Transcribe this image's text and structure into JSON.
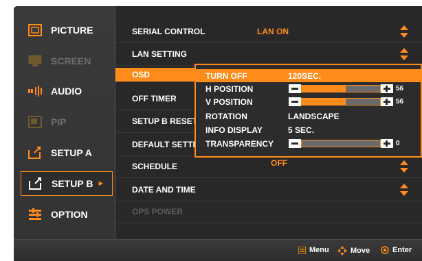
{
  "colors": {
    "accent": "#ff8c1a",
    "background": "#2a2a2a",
    "dim_text": "#5e5e5e"
  },
  "left_menu": {
    "items": [
      {
        "label": "PICTURE",
        "icon": "picture-icon",
        "state": "normal"
      },
      {
        "label": "SCREEN",
        "icon": "screen-icon",
        "state": "disabled"
      },
      {
        "label": "AUDIO",
        "icon": "audio-icon",
        "state": "normal"
      },
      {
        "label": "PIP",
        "icon": "pip-icon",
        "state": "disabled"
      },
      {
        "label": "SETUP A",
        "icon": "setup-a-icon",
        "state": "normal"
      },
      {
        "label": "SETUP B",
        "icon": "setup-b-icon",
        "state": "selected",
        "arrow": "►"
      },
      {
        "label": "OPTION",
        "icon": "option-icon",
        "state": "normal"
      }
    ]
  },
  "setup_b": {
    "rows": [
      {
        "label": "SERIAL CONTROL",
        "value": "LAN ON",
        "has_arrows": true
      },
      {
        "label": "LAN SETTING",
        "value": "",
        "has_arrows": true
      },
      {
        "label": "OSD",
        "value": "",
        "has_arrows": false,
        "highlighted": true
      },
      {
        "label": "OFF TIMER",
        "value": "",
        "has_arrows": false
      },
      {
        "label": "SETUP B RESET",
        "value": "",
        "has_arrows": false
      },
      {
        "label": "DEFAULT SETTING",
        "value": "",
        "has_arrows": false
      },
      {
        "label": "SCHEDULE",
        "value": "OFF",
        "has_arrows": true
      },
      {
        "label": "DATE AND TIME",
        "value": "",
        "has_arrows": true
      },
      {
        "label": "OPS POWER",
        "value": "",
        "has_arrows": false,
        "disabled": true
      }
    ]
  },
  "osd_submenu": {
    "turn_off": {
      "label": "TURN OFF",
      "value": "120SEC."
    },
    "h_position": {
      "label": "H POSITION",
      "value": "56",
      "level": 0.56
    },
    "v_position": {
      "label": "V POSITION",
      "value": "56",
      "level": 0.56
    },
    "rotation": {
      "label": "ROTATION",
      "value": "LANDSCAPE"
    },
    "info_display": {
      "label": "INFO DISPLAY",
      "value": "5 SEC."
    },
    "transparency": {
      "label": "TRANSPARENCY",
      "value": "0",
      "level": 0.0
    }
  },
  "footer": {
    "menu": {
      "label": "Menu",
      "icon": "menu-icon"
    },
    "move": {
      "label": "Move",
      "icon": "move-icon"
    },
    "enter": {
      "label": "Enter",
      "icon": "enter-icon"
    }
  }
}
